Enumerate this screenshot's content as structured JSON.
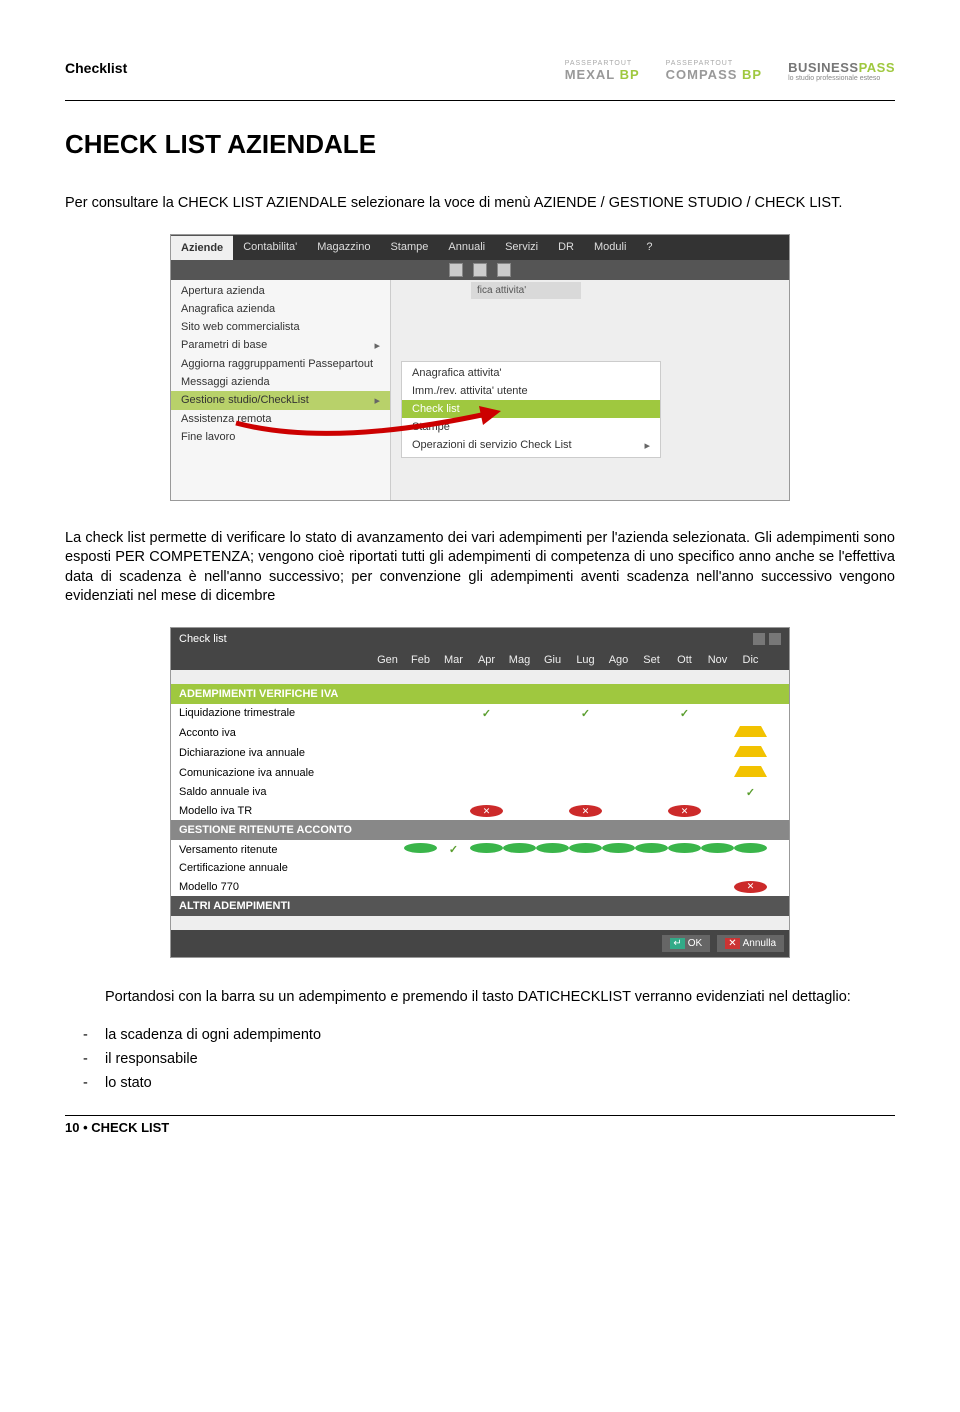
{
  "header": {
    "section": "Checklist",
    "logos": {
      "mexal_small": "PASSEPARTOUT",
      "mexal": "MEXAL",
      "bp": "BP",
      "compass_small": "PASSEPARTOUT",
      "compass": "COMPASS",
      "biz": "BUSINESS",
      "biz2": "PASS",
      "biz_tag": "lo studio professionale esteso"
    }
  },
  "title": "CHECK LIST AZIENDALE",
  "p1": "Per consultare la CHECK LIST AZIENDALE selezionare la voce di menù AZIENDE  / GESTIONE STUDIO / CHECK LIST.",
  "p2": "La check list permette di verificare lo stato di avanzamento dei vari adempimenti per l'azienda selezionata. Gli adempimenti sono esposti PER COMPETENZA; vengono cioè riportati tutti gli adempimenti di competenza di uno specifico anno anche se l'effettiva data di scadenza è nell'anno successivo; per convenzione gli adempimenti aventi scadenza nell'anno successivo vengono evidenziati nel mese di dicembre",
  "shot1": {
    "menu": [
      "Aziende",
      "Contabilita'",
      "Magazzino",
      "Stampe",
      "Annuali",
      "Servizi",
      "DR",
      "Moduli",
      "?"
    ],
    "sub_tag": "fica attivita'",
    "left": [
      "Apertura azienda",
      "Anagrafica azienda",
      "Sito web commercialista",
      "Parametri di base",
      "Aggiorna raggruppamenti Passepartout",
      "Messaggi azienda",
      "Gestione studio/CheckList",
      "Assistenza remota",
      "Fine lavoro"
    ],
    "right": [
      "Anagrafica attivita'",
      "Imm./rev. attivita' utente",
      "Check list",
      "Stampe",
      "Operazioni di servizio Check List"
    ]
  },
  "shot2": {
    "title": "Check list",
    "months": [
      "Gen",
      "Feb",
      "Mar",
      "Apr",
      "Mag",
      "Giu",
      "Lug",
      "Ago",
      "Set",
      "Ott",
      "Nov",
      "Dic"
    ],
    "sec1": "ADEMPIMENTI VERIFICHE IVA",
    "rows1": [
      {
        "label": "Liquidazione trimestrale",
        "cells": [
          "",
          "",
          "",
          "ck",
          "",
          "",
          "ck",
          "",
          "",
          "ck",
          "",
          ""
        ]
      },
      {
        "label": "Acconto iva",
        "cells": [
          "",
          "",
          "",
          "",
          "",
          "",
          "",
          "",
          "",
          "",
          "",
          "wn"
        ]
      },
      {
        "label": "Dichiarazione iva annuale",
        "cells": [
          "",
          "",
          "",
          "",
          "",
          "",
          "",
          "",
          "",
          "",
          "",
          "wn"
        ]
      },
      {
        "label": "Comunicazione iva annuale",
        "cells": [
          "",
          "",
          "",
          "",
          "",
          "",
          "",
          "",
          "",
          "",
          "",
          "wn"
        ]
      },
      {
        "label": "Saldo annuale iva",
        "cells": [
          "",
          "",
          "",
          "",
          "",
          "",
          "",
          "",
          "",
          "",
          "",
          "ck"
        ]
      },
      {
        "label": "Modello iva TR",
        "cells": [
          "",
          "",
          "",
          "xr",
          "",
          "",
          "xr",
          "",
          "",
          "xr",
          "",
          ""
        ]
      }
    ],
    "sec2": "GESTIONE RITENUTE ACCONTO",
    "rows2": [
      {
        "label": "Versamento ritenute",
        "cells": [
          "",
          "dg",
          "ck",
          "dg",
          "dg",
          "dg",
          "dg",
          "dg",
          "dg",
          "dg",
          "dg",
          "dg"
        ]
      },
      {
        "label": "Certificazione annuale",
        "cells": [
          "",
          "",
          "",
          "",
          "",
          "",
          "",
          "",
          "",
          "",
          "",
          ""
        ]
      },
      {
        "label": "Modello 770",
        "cells": [
          "",
          "",
          "",
          "",
          "",
          "",
          "",
          "",
          "",
          "",
          "",
          "xr"
        ]
      }
    ],
    "sec3": "ALTRI ADEMPIMENTI",
    "btn_ok": "OK",
    "btn_cancel": "Annulla"
  },
  "p3": "Portandosi con la barra su un adempimento  e premendo il tasto DATICHECKLIST verranno evidenziati nel dettaglio:",
  "bullets": [
    "la scadenza di ogni adempimento",
    "il responsabile",
    "lo stato"
  ],
  "footer": "10 • CHECK LIST"
}
